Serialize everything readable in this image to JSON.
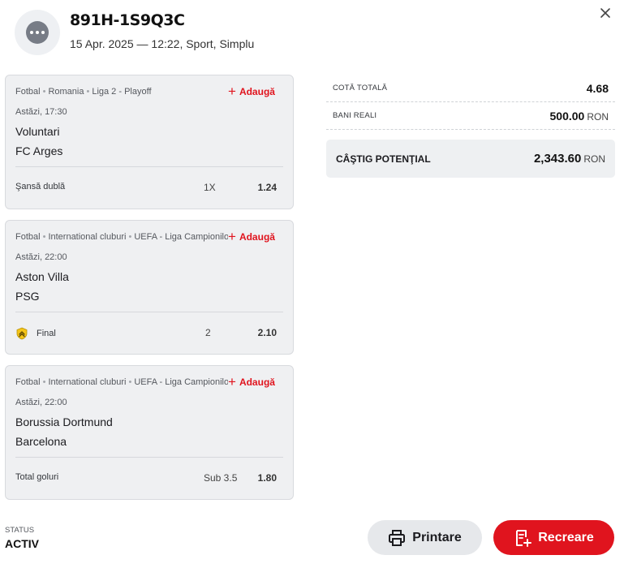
{
  "ticket": {
    "id": "891H-1S9Q3C",
    "meta": "15 Apr. 2025 — 12:22, Sport, Simplu"
  },
  "add_label": "Adaugă",
  "events": [
    {
      "sport": "Fotbal",
      "country": "Romania",
      "league": "Liga 2 - Playoff",
      "time": "Astăzi, 17:30",
      "home": "Voluntari",
      "away": "FC Arges",
      "market": "Şansă dublă",
      "market_icon": "none",
      "pick": "1X",
      "odd": "1.24"
    },
    {
      "sport": "Fotbal",
      "country": "International cluburi",
      "league": "UEFA - Liga Campionilor",
      "time": "Astăzi, 22:00",
      "home": "Aston Villa",
      "away": "PSG",
      "market": "Final",
      "market_icon": "chevron-up-badge-icon",
      "pick": "2",
      "odd": "2.10"
    },
    {
      "sport": "Fotbal",
      "country": "International cluburi",
      "league": "UEFA - Liga Campionilor",
      "time": "Astăzi, 22:00",
      "home": "Borussia Dortmund",
      "away": "Barcelona",
      "market": "Total goluri",
      "market_icon": "none",
      "pick": "Sub 3.5",
      "odd": "1.80"
    }
  ],
  "summary": {
    "total_odds_label": "COTĂ TOTALĂ",
    "total_odds": "4.68",
    "stake_label": "BANI REALI",
    "stake": "500.00",
    "currency": "RON",
    "potential_label": "CÂŞTIG POTENŢIAL",
    "potential": "2,343.60"
  },
  "status": {
    "label": "STATUS",
    "value": "ACTIV"
  },
  "buttons": {
    "print": "Printare",
    "recreate": "Recreare"
  },
  "colors": {
    "accent": "#e0141e",
    "card_bg": "#eff0f2",
    "badge": "#f5c518"
  }
}
